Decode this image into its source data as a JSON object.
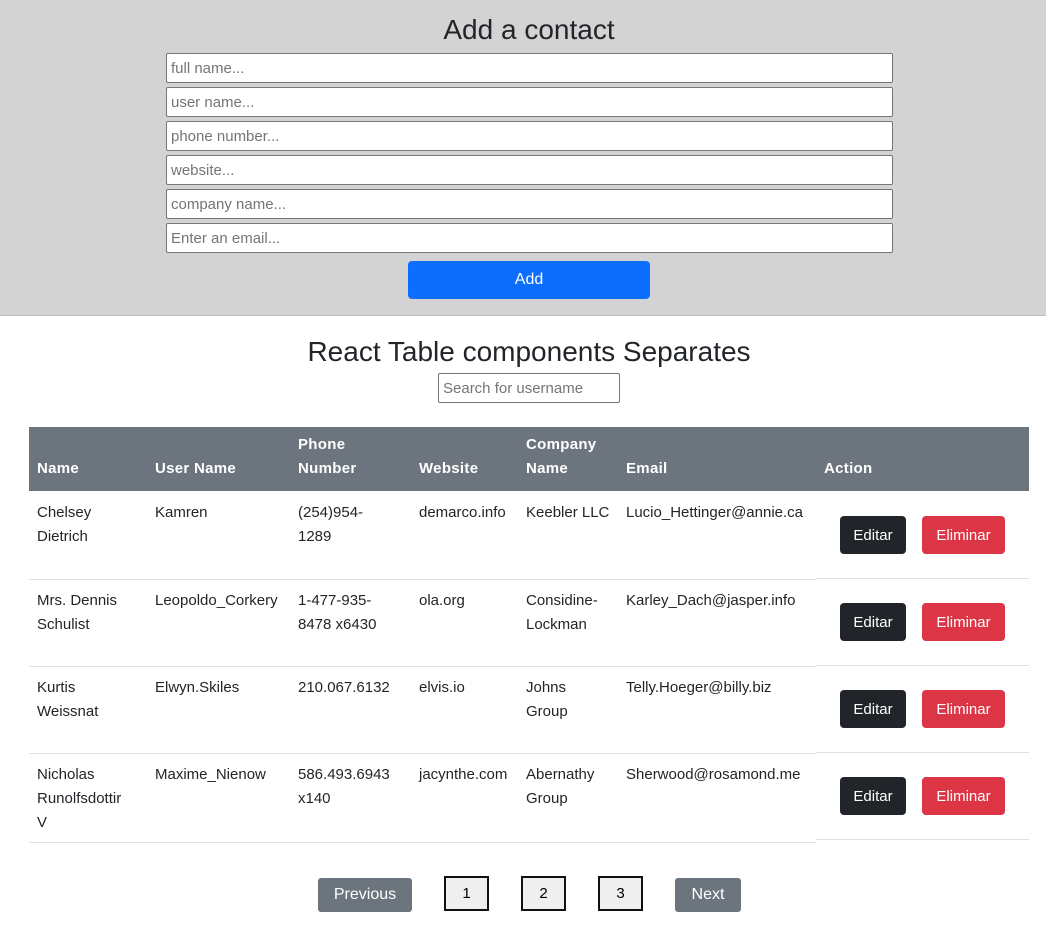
{
  "add_form": {
    "title": "Add a contact",
    "placeholders": {
      "full_name": "full name...",
      "user_name": "user name...",
      "phone": "phone number...",
      "website": "website...",
      "company": "company name...",
      "email": "Enter an email..."
    },
    "add_label": "Add"
  },
  "table_section": {
    "title": "React Table components Separates",
    "search_placeholder": "Search for username"
  },
  "table": {
    "headers": {
      "name": "Name",
      "username": "User Name",
      "phone_line1": "Phone",
      "phone_line2": "Number",
      "website": "Website",
      "company_line1": "Company",
      "company_line2": "Name",
      "email": "Email",
      "action": "Action"
    },
    "rows": [
      {
        "name_lines": [
          "Chelsey",
          "Dietrich"
        ],
        "username": "Kamren",
        "phone_lines": [
          "(254)954-",
          "1289"
        ],
        "website": "demarco.info",
        "company_lines": [
          "Keebler LLC"
        ],
        "email": "Lucio_Hettinger@annie.ca"
      },
      {
        "name_lines": [
          "Mrs. Dennis",
          "Schulist"
        ],
        "username": "Leopoldo_Corkery",
        "phone_lines": [
          "1-477-935-",
          "8478 x6430"
        ],
        "website": "ola.org",
        "company_lines": [
          "Considine-",
          "Lockman"
        ],
        "email": "Karley_Dach@jasper.info"
      },
      {
        "name_lines": [
          "Kurtis",
          "Weissnat"
        ],
        "username": "Elwyn.Skiles",
        "phone_lines": [
          "210.067.6132"
        ],
        "website": "elvis.io",
        "company_lines": [
          "Johns",
          "Group"
        ],
        "email": "Telly.Hoeger@billy.biz"
      },
      {
        "name_lines": [
          "Nicholas",
          "Runolfsdottir",
          "V"
        ],
        "username": "Maxime_Nienow",
        "phone_lines": [
          "586.493.6943",
          "x140"
        ],
        "website": "jacynthe.com",
        "company_lines": [
          "Abernathy",
          "Group"
        ],
        "email": "Sherwood@rosamond.me"
      }
    ],
    "edit_label": "Editar",
    "delete_label": "Eliminar"
  },
  "pagination": {
    "previous": "Previous",
    "pages": [
      "1",
      "2",
      "3"
    ],
    "next": "Next"
  }
}
